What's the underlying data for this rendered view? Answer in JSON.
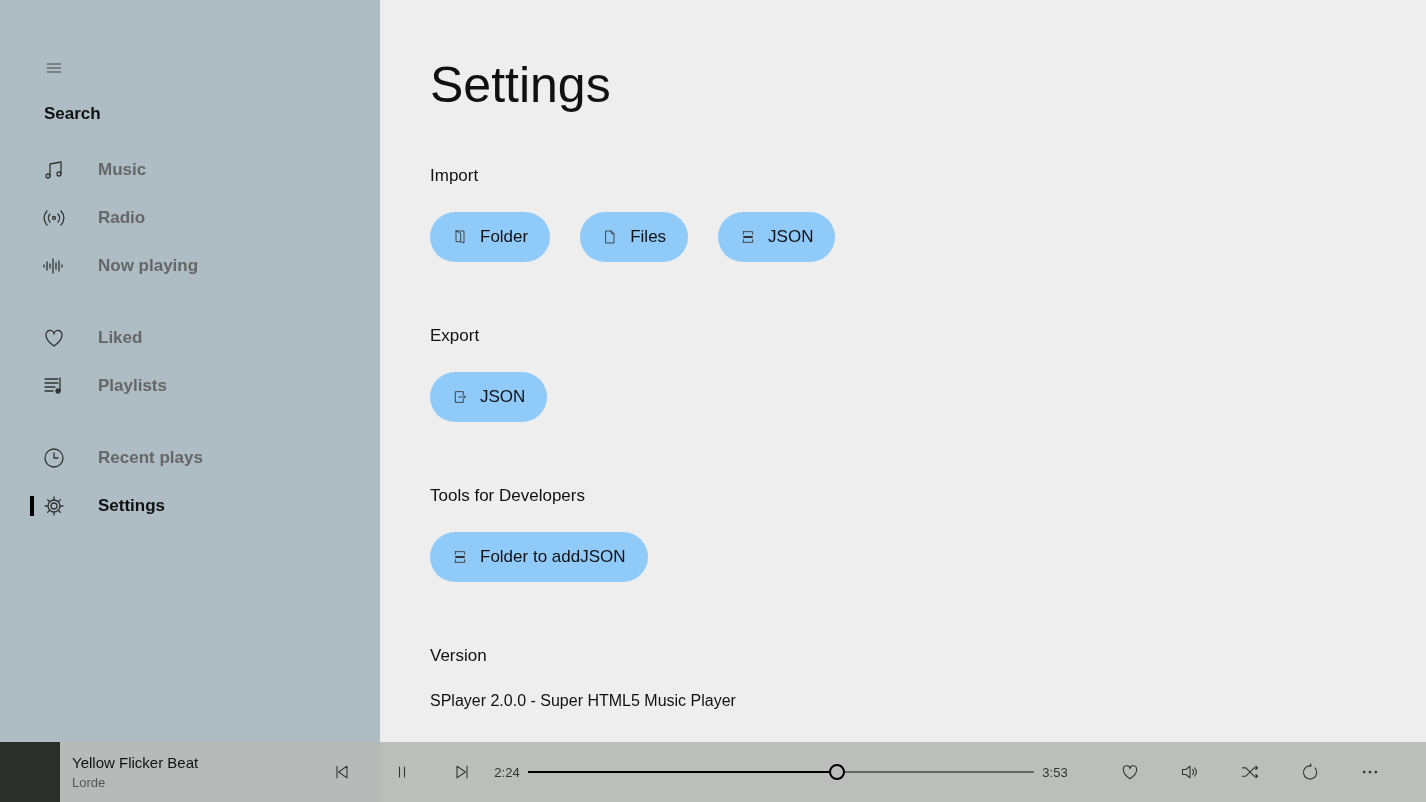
{
  "sidebar": {
    "search_label": "Search",
    "groups": [
      [
        {
          "label": "Music",
          "selected": false
        },
        {
          "label": "Radio",
          "selected": false
        },
        {
          "label": "Now playing",
          "selected": false
        }
      ],
      [
        {
          "label": "Liked",
          "selected": false
        },
        {
          "label": "Playlists",
          "selected": false
        }
      ],
      [
        {
          "label": "Recent plays",
          "selected": false
        },
        {
          "label": "Settings",
          "selected": true
        }
      ]
    ]
  },
  "main": {
    "title": "Settings",
    "sections": [
      {
        "heading": "Import",
        "buttons": [
          "Folder",
          "Files",
          "JSON"
        ]
      },
      {
        "heading": "Export",
        "buttons": [
          "JSON"
        ]
      },
      {
        "heading": "Tools for Developers",
        "buttons": [
          "Folder to addJSON"
        ]
      },
      {
        "heading": "Version",
        "text": "SPlayer 2.0.0 - Super HTML5 Music Player"
      }
    ]
  },
  "player": {
    "title": "Yellow Flicker Beat",
    "artist": "Lorde",
    "elapsed": "2:24",
    "duration": "3:53",
    "level": 0.61
  }
}
